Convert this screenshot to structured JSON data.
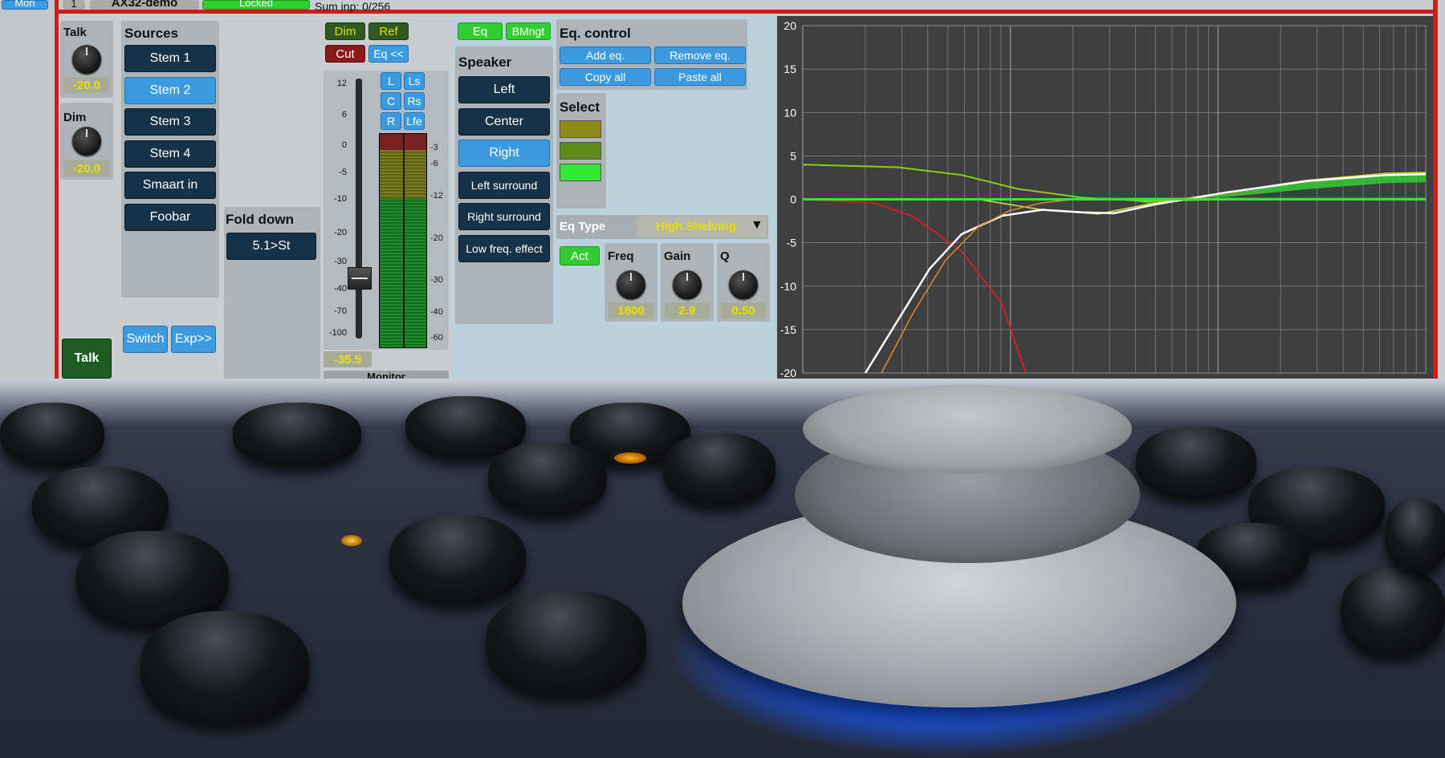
{
  "topbar": {
    "mon_label": "Mon",
    "index_label": "1",
    "device_name": "AX32-demo",
    "locked_label": "Locked",
    "sum_input": "Sum inp: 0/256"
  },
  "talk_panel": {
    "title": "Talk",
    "value": "-20.0"
  },
  "dim_panel": {
    "title": "Dim",
    "value": "-20.0"
  },
  "talk_button": "Talk",
  "sources": {
    "title": "Sources",
    "items": [
      "Stem 1",
      "Stem 2",
      "Stem 3",
      "Stem 4",
      "Smaart in",
      "Foobar"
    ],
    "selected_index": 1,
    "switch_label": "Switch",
    "exp_label": "Exp>>"
  },
  "fold_down": {
    "title": "Fold down",
    "button_label": "5.1>St"
  },
  "monitor_controls": {
    "dim_label": "Dim",
    "ref_label": "Ref",
    "cut_label": "Cut",
    "eq_label": "Eq <<",
    "channels": [
      "L",
      "Ls",
      "C",
      "Rs",
      "R",
      "Lfe"
    ],
    "fader_scale": [
      "12",
      "6",
      "0",
      "-5",
      "-10",
      "-20",
      "-30",
      "-40",
      "-70",
      "-100"
    ],
    "meter_scale": [
      "-3",
      "-6",
      "-12",
      "-20",
      "-30",
      "-40",
      "-60"
    ],
    "fader_value": "-35.5",
    "fader_level_db": -35.5,
    "monitor_label": "Monitor"
  },
  "eq_tabs": {
    "eq_label": "Eq",
    "bmngt_label": "BMngt"
  },
  "speaker": {
    "title": "Speaker",
    "items": [
      "Left",
      "Center",
      "Right",
      "Left surround",
      "Right surround",
      "Low freq. effect"
    ],
    "selected_index": 2
  },
  "eq_control": {
    "title": "Eq. control",
    "add_label": "Add eq.",
    "remove_label": "Remove eq.",
    "copy_label": "Copy all",
    "paste_label": "Paste all"
  },
  "select_panel": {
    "title": "Select",
    "swatch_colors": [
      "#8f8a16",
      "#5e8a1a",
      "#33e833"
    ]
  },
  "eq_type": {
    "label": "Eq Type",
    "value": "High Shelving"
  },
  "eq_params": {
    "act_label": "Act",
    "freq": {
      "label": "Freq",
      "value": "1800"
    },
    "gain": {
      "label": "Gain",
      "value": "2.9"
    },
    "q": {
      "label": "Q",
      "value": "0.50"
    }
  },
  "eq_graph": {
    "y_ticks": [
      "20",
      "15",
      "10",
      "5",
      "0",
      "-5",
      "-10",
      "-15",
      "-20"
    ],
    "ylim": [
      -20,
      20
    ],
    "colors": {
      "background": "#3f3f3f",
      "grid": "#8a8a8a"
    }
  }
}
